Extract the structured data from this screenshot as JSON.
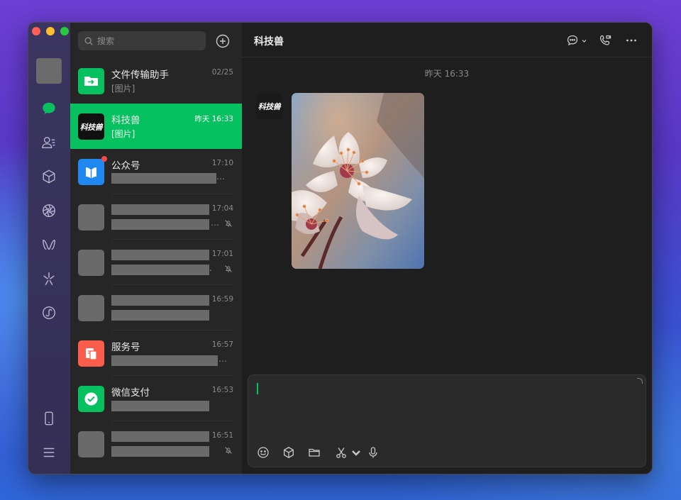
{
  "search": {
    "placeholder": "搜索"
  },
  "chat_list": [
    {
      "name": "文件传输助手",
      "preview": "[图片]",
      "time": "02/25",
      "avatar_color": "#07c160",
      "icon": "folder-transfer-icon"
    },
    {
      "name": "科技兽",
      "preview": "[图片]",
      "time": "昨天 16:33",
      "active": true,
      "avatar_text": "科技兽",
      "avatar_color": "#111111"
    },
    {
      "name": "公众号",
      "preview": "",
      "time": "17:10",
      "avatar_color": "#1e88f0",
      "icon": "official-accounts-icon",
      "unread_dot": true
    },
    {
      "name": "",
      "preview": "",
      "time": "17:04",
      "muted": true
    },
    {
      "name": "",
      "preview": "",
      "time": "17:01",
      "muted": true
    },
    {
      "name": "",
      "preview": "",
      "time": "16:59"
    },
    {
      "name": "服务号",
      "preview": "",
      "time": "16:57",
      "avatar_color": "#fa5d4b",
      "icon": "service-account-icon"
    },
    {
      "name": "微信支付",
      "preview": "",
      "time": "16:53",
      "avatar_color": "#07c160",
      "icon": "wechat-pay-icon"
    },
    {
      "name": "",
      "preview": "",
      "time": "16:51",
      "muted": true
    }
  ],
  "conversation": {
    "title": "科技兽",
    "timestamp": "昨天 16:33",
    "sender_avatar_text": "科技兽"
  },
  "colors": {
    "accent": "#07c160",
    "unread": "#f54a45"
  }
}
